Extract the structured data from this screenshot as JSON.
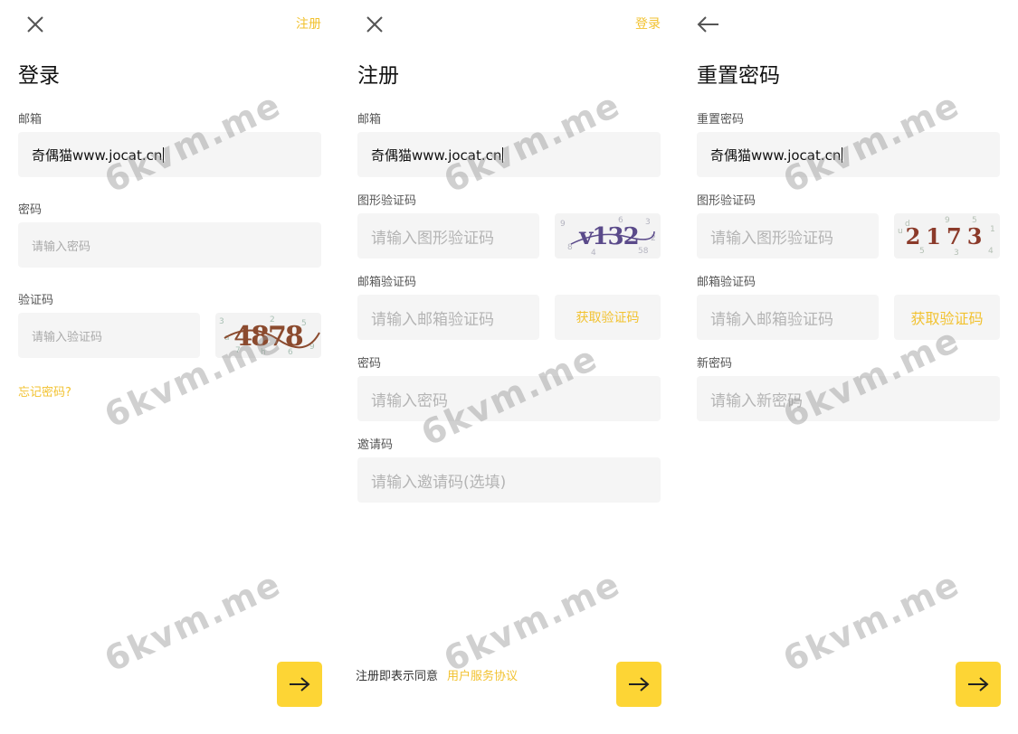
{
  "login": {
    "close_icon": "close-icon",
    "register_link": "注册",
    "title": "登录",
    "email_label": "邮箱",
    "email_value": "奇偶猫www.jocat.cn",
    "password_label": "密码",
    "password_placeholder": "请输入密码",
    "captcha_label": "验证码",
    "captcha_placeholder": "请输入验证码",
    "captcha_text": "4878",
    "forgot_link": "忘记密码?",
    "next_icon": "arrow-right-icon"
  },
  "register": {
    "close_icon": "close-icon",
    "login_link": "登录",
    "title": "注册",
    "email_label": "邮箱",
    "email_value": "奇偶猫www.jocat.cn",
    "image_code_label": "图形验证码",
    "image_code_placeholder": "请输入图形验证码",
    "captcha_text": "v132",
    "email_code_label": "邮箱验证码",
    "email_code_placeholder": "请输入邮箱验证码",
    "get_code_button": "获取验证码",
    "password_label": "密码",
    "password_placeholder": "请输入密码",
    "invite_label": "邀请码",
    "invite_placeholder": "请输入邀请码(选填)",
    "agree_text": "注册即表示同意",
    "agreement_link": "用户服务协议",
    "next_icon": "arrow-right-icon"
  },
  "reset": {
    "back_icon": "arrow-left-icon",
    "title": "重置密码",
    "email_label": "重置密码",
    "email_value": "奇偶猫www.jocat.cn",
    "image_code_label": "图形验证码",
    "image_code_placeholder": "请输入图形验证码",
    "captcha_text": "2173",
    "email_code_label": "邮箱验证码",
    "email_code_placeholder": "请输入邮箱验证码",
    "get_code_button": "获取验证码",
    "new_password_label": "新密码",
    "new_password_placeholder": "请输入新密码",
    "next_icon": "arrow-right-icon"
  },
  "watermark": "6kvm.me",
  "colors": {
    "accent": "#f2c230",
    "button": "#fdd535",
    "field_bg": "#f5f5f5"
  }
}
